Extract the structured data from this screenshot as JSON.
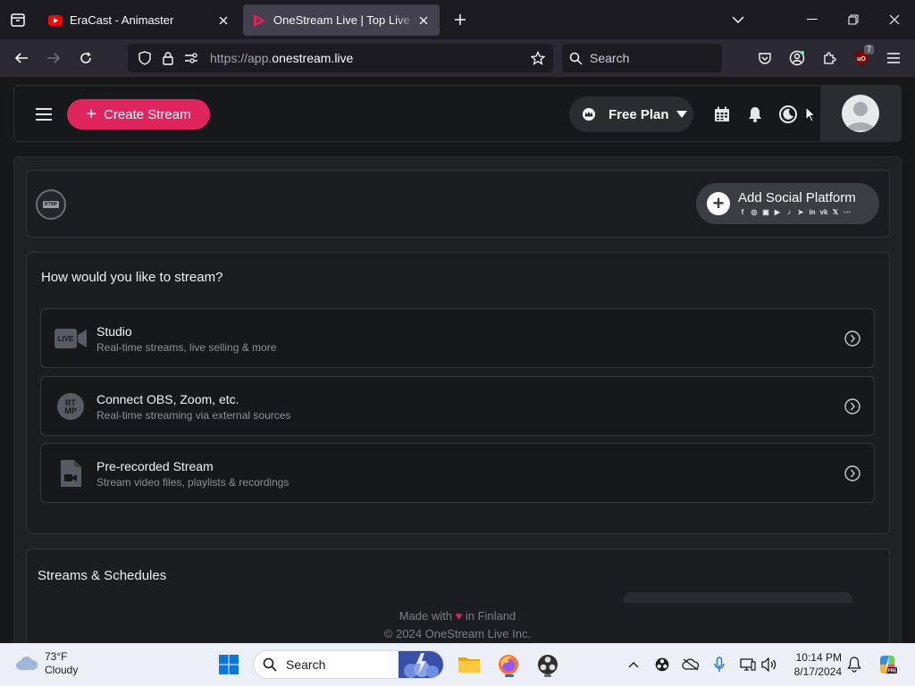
{
  "browser": {
    "tabs": [
      {
        "title": "EraCast - Animaster",
        "active": false
      },
      {
        "title": "OneStream Live | Top Live Strea",
        "active": true
      }
    ],
    "url_prefix": "https://app.",
    "url_host": "onestream.live",
    "search_placeholder": "Search",
    "extension_badge": "7"
  },
  "app": {
    "create_button": "Create Stream",
    "plan_label": "Free Plan",
    "rtmp_badge": "RTMP",
    "add_social": {
      "label": "Add Social Platform",
      "platforms": [
        "f",
        "◎",
        "▣",
        "▶",
        "♪",
        "➤",
        "in",
        "vk",
        "𝕏",
        "⋯"
      ]
    },
    "stream_question": "How would you like to stream?",
    "options": [
      {
        "title": "Studio",
        "desc": "Real-time streams, live selling & more",
        "icon": "live-camera-icon"
      },
      {
        "title": "Connect OBS, Zoom, etc.",
        "desc": "Real-time streaming via external sources",
        "icon": "rtmp-icon"
      },
      {
        "title": "Pre-recorded Stream",
        "desc": "Stream video files, playlists & recordings",
        "icon": "video-file-icon"
      }
    ],
    "schedules_title": "Streams & Schedules",
    "footer": {
      "made_with": "Made with",
      "heart": "♥",
      "in_finland": "in Finland",
      "copyright": "© 2024 OneStream Live Inc."
    },
    "accent_color": "#e0245e"
  },
  "taskbar": {
    "temperature": "73°F",
    "condition": "Cloudy",
    "search_label": "Search",
    "time": "10:14 PM",
    "date": "8/17/2024"
  }
}
